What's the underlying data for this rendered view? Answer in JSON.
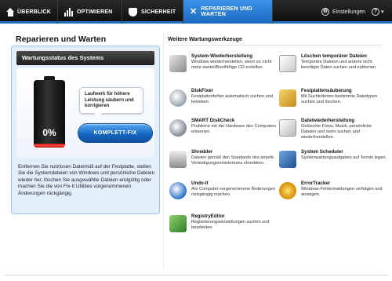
{
  "nav": {
    "tabs": [
      {
        "label": "ÜBERBLICK",
        "icon": "home-icon"
      },
      {
        "label": "OPTIMIEREN",
        "icon": "bar-chart-icon"
      },
      {
        "label": "SICHERHEIT",
        "icon": "shield-icon"
      },
      {
        "label": "REPARIEREN UND WARTEN",
        "icon": "tools-icon",
        "active": true
      }
    ],
    "settings_label": "Einstellungen",
    "help_label": "?"
  },
  "page_title": "Reparieren und Warten",
  "status": {
    "header": "Wartungsstatus des Systems",
    "battery_percent_text": "0%",
    "battery_level": 0.06,
    "bubble_text": "Laufwerk für höhere Leistung säubern und korrigieren",
    "fix_button_label": "KOMPLETT-FIX",
    "description": "Entfernen Sie nutzlosen Dateimüll auf der Festplatte, stellen Sie die Systemdateien von Windows und persönliche Dateien wieder her, löschen Sie ausgewählte Dateien endgültig oder machen Sie die von Fix-It Utilities vorgenommenen Änderungen rückgängig."
  },
  "tools_title": "Weitere Wartungswerkzeuge",
  "tools": [
    {
      "name": "System-Wiederherstellung",
      "desc": "Windows wiederherstellen, wenn es nicht mehr startet/Bootfähige CD erstellen.",
      "icon": "system-restore-icon"
    },
    {
      "name": "Löschen temporärer Dateien",
      "desc": "Temporäre Dateien und andere nicht benötigte Daten suchen und entfernen.",
      "icon": "temp-files-icon"
    },
    {
      "name": "DiskFixer",
      "desc": "Festplattenfehler automatisch suchen und beheben.",
      "icon": "disk-fixer-icon"
    },
    {
      "name": "Festplattensäuberung",
      "desc": "Mit Suchkriterien bestimmte Dateitypen suchen und löschen.",
      "icon": "disk-cleanup-icon"
    },
    {
      "name": "SMART DiskCheck",
      "desc": "Probleme mit der Hardware des Computers erkennen.",
      "icon": "smart-diskcheck-icon"
    },
    {
      "name": "Dateiwiederherstellung",
      "desc": "Gelöschte Fotos, Musik, persönliche Dateien und mehr suchen und wiederherstellen.",
      "icon": "file-recovery-icon"
    },
    {
      "name": "Shredder",
      "desc": "Dateien gemäß den Standards des amerik. Verteidigungsministeriums shreddern.",
      "icon": "shredder-icon"
    },
    {
      "name": "System Scheduler",
      "desc": "Systemwartungsaufgaben auf Termin legen.",
      "icon": "scheduler-icon"
    },
    {
      "name": "Undo-It",
      "desc": "Am Computer vorgenommene Änderungen rückgängig machen.",
      "icon": "undo-icon"
    },
    {
      "name": "ErrorTracker",
      "desc": "Windows-Fehlermeldungen verfolgen und anzeigen.",
      "icon": "error-tracker-icon"
    },
    {
      "name": "RegistryEditor",
      "desc": "Registrierungseinstellungen suchen und bearbeiten.",
      "icon": "registry-editor-icon"
    }
  ]
}
